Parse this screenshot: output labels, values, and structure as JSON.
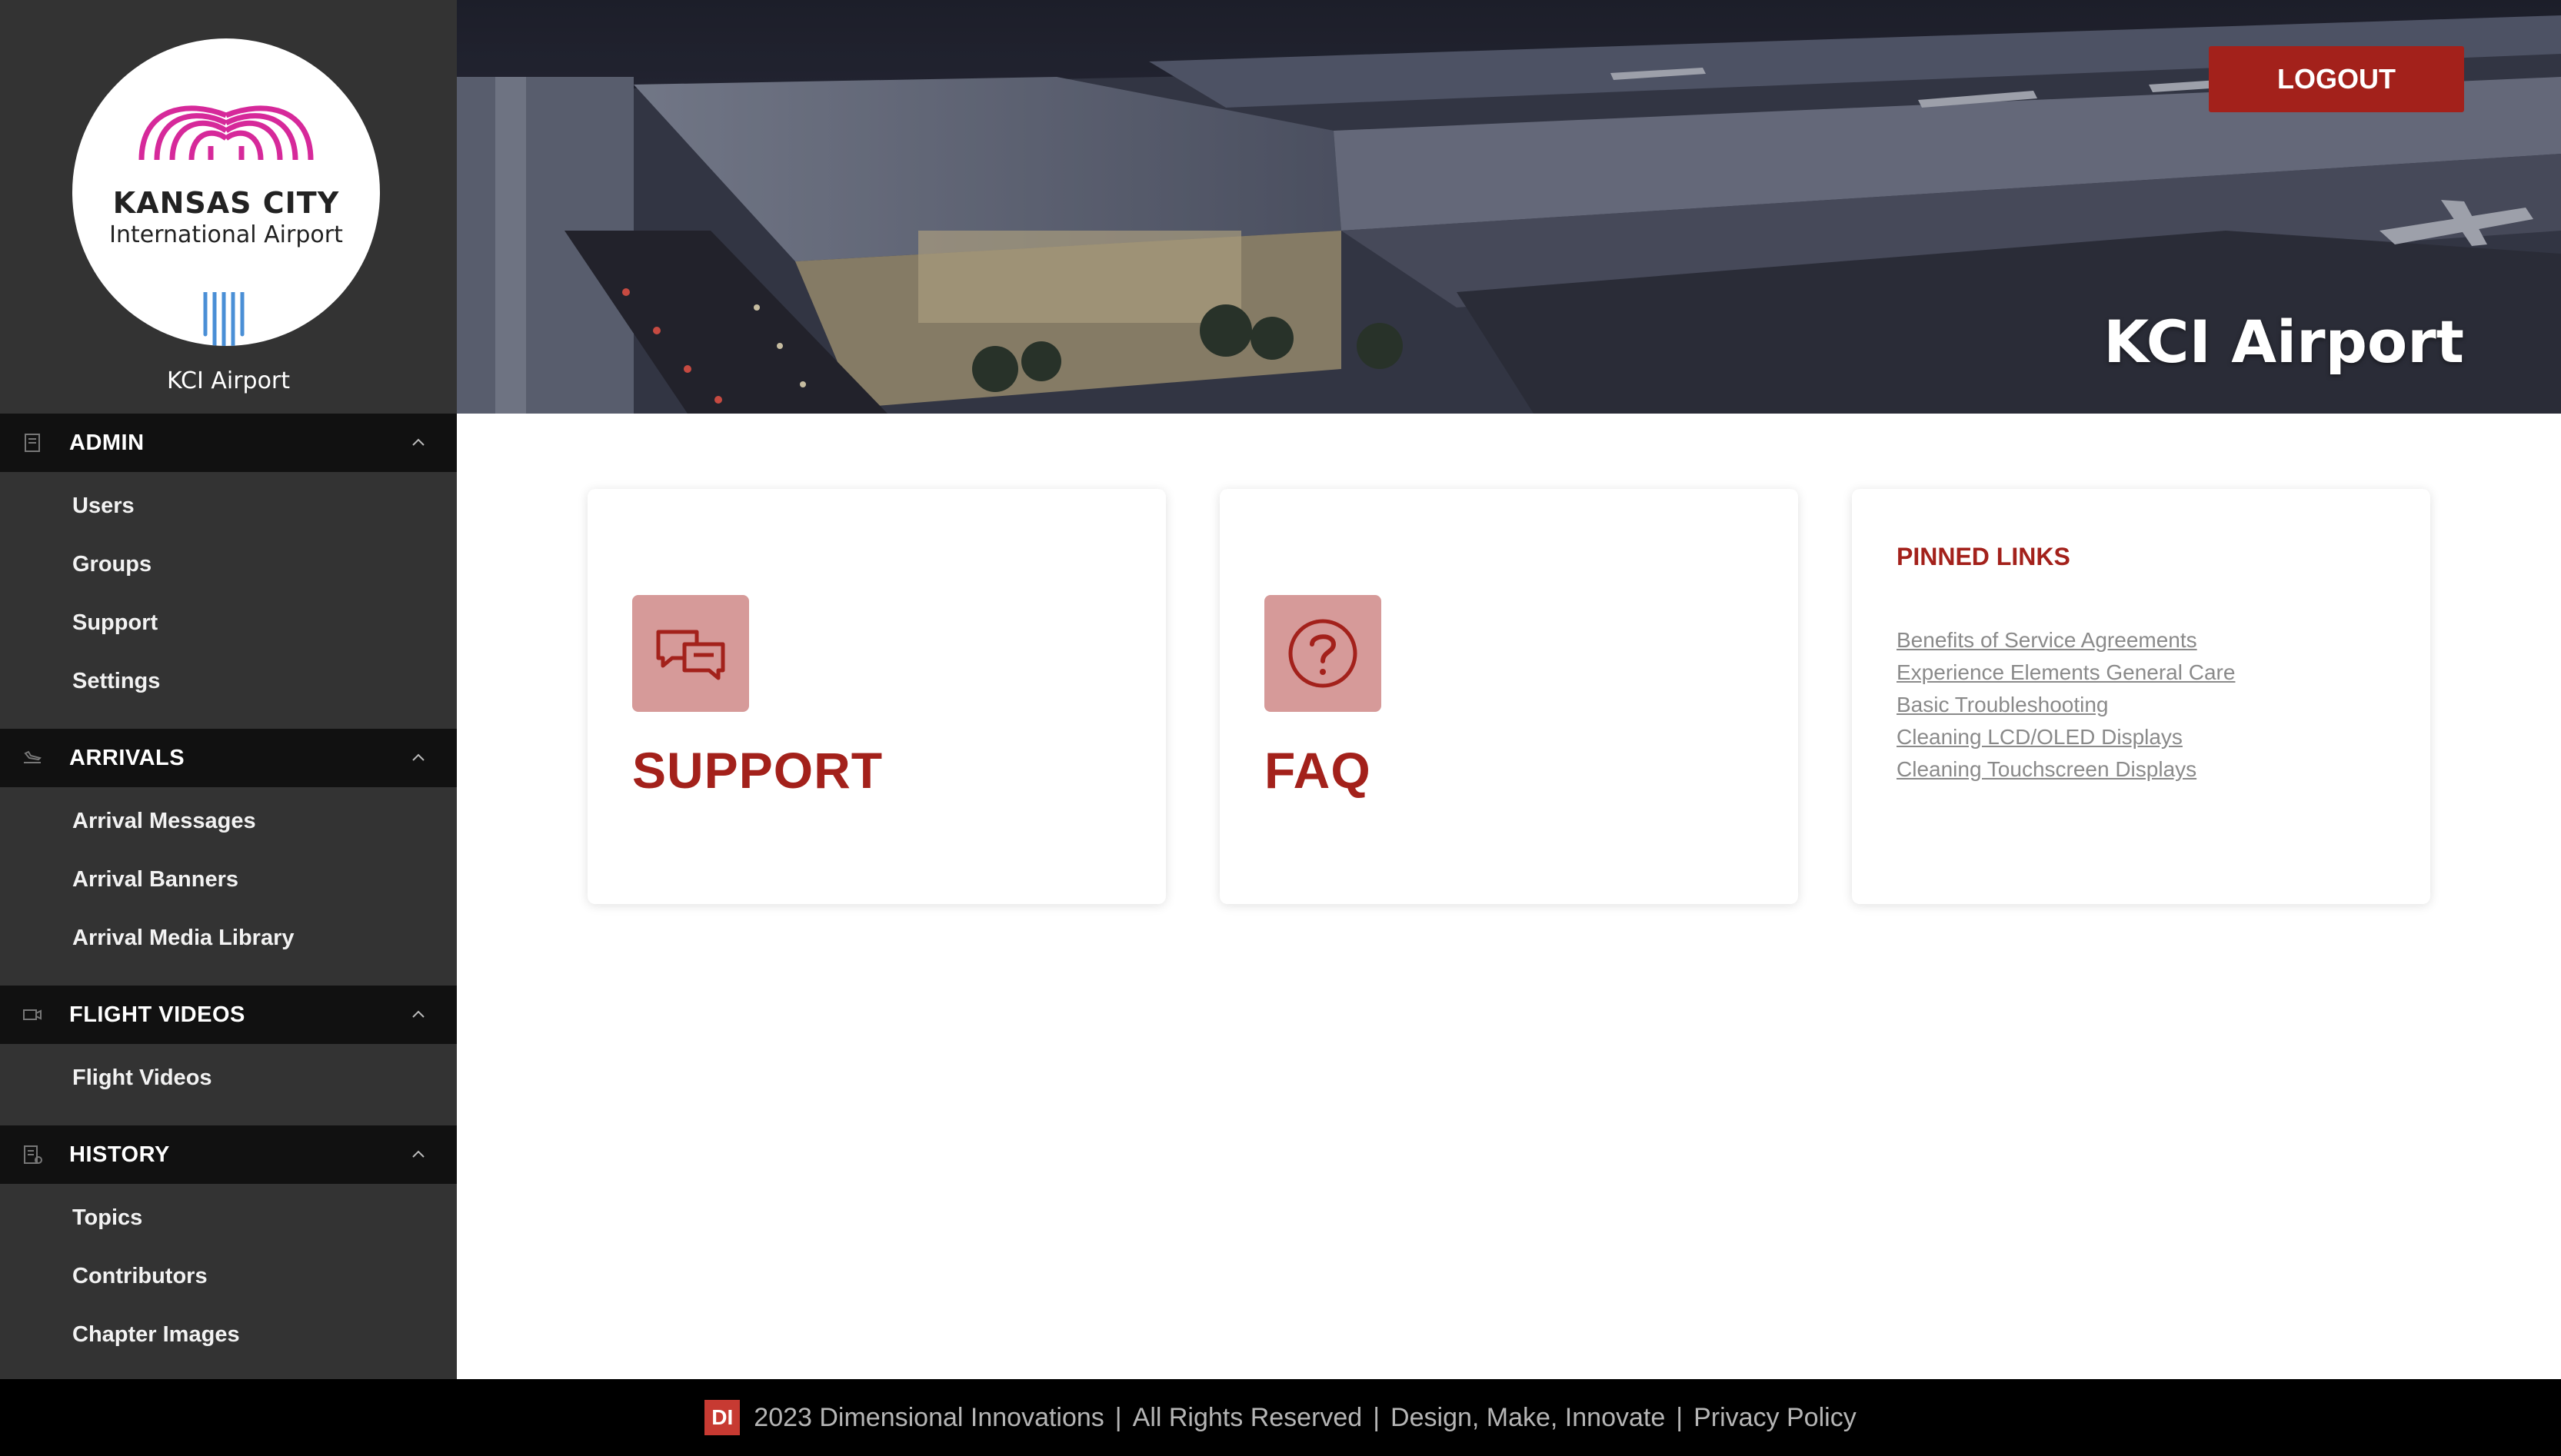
{
  "sidebar": {
    "logo": {
      "line1": "KANSAS CITY",
      "line2": "International Airport",
      "colors": {
        "arch": "#d6299a",
        "lines": "#4a8fd6"
      }
    },
    "site_name": "KCI Airport",
    "sections": [
      {
        "label": "ADMIN",
        "icon": "document-icon",
        "items": [
          "Users",
          "Groups",
          "Support",
          "Settings"
        ]
      },
      {
        "label": "ARRIVALS",
        "icon": "plane-landing-icon",
        "items": [
          "Arrival Messages",
          "Arrival Banners",
          "Arrival Media Library"
        ]
      },
      {
        "label": "FLIGHT VIDEOS",
        "icon": "video-camera-icon",
        "items": [
          "Flight Videos"
        ]
      },
      {
        "label": "HISTORY",
        "icon": "history-document-icon",
        "items": [
          "Topics",
          "Contributors",
          "Chapter Images"
        ]
      }
    ]
  },
  "header": {
    "logout_label": "LOGOUT",
    "title": "KCI Airport"
  },
  "cards": {
    "support": {
      "title": "SUPPORT",
      "icon": "chat-bubbles-icon"
    },
    "faq": {
      "title": "FAQ",
      "icon": "question-circle-icon"
    },
    "pinned": {
      "title": "PINNED LINKS",
      "links": [
        "Benefits of Service Agreements",
        "Experience Elements General Care",
        "Basic Troubleshooting",
        "Cleaning LCD/OLED Displays",
        "Cleaning Touchscreen Displays"
      ]
    }
  },
  "footer": {
    "logo": "DI",
    "copyright": "2023 Dimensional Innovations",
    "rights": "All Rights Reserved",
    "tagline": "Design, Make, Innovate",
    "privacy": "Privacy Policy"
  },
  "colors": {
    "accent": "#a3211b",
    "sidebar_bg": "#333333",
    "section_bg": "#111111",
    "icon_tile": "#d69a99"
  }
}
